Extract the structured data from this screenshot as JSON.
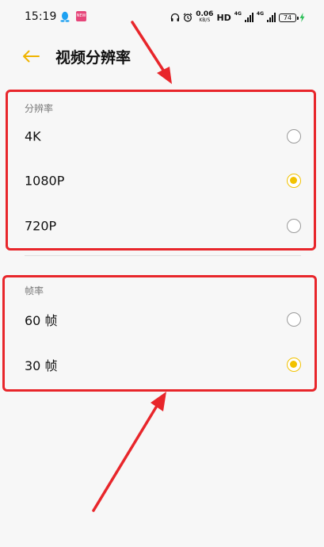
{
  "status_bar": {
    "time": "15:19",
    "app_icon_text": "NEW",
    "net_speed": "0.06",
    "net_speed_unit": "KB/S",
    "hd_label": "HD",
    "net_type_1": "4G",
    "net_type_2": "4G",
    "battery": "74"
  },
  "header": {
    "title": "视频分辨率"
  },
  "resolution_section": {
    "label": "分辨率",
    "options": [
      {
        "label": "4K",
        "selected": false
      },
      {
        "label": "1080P",
        "selected": true
      },
      {
        "label": "720P",
        "selected": false
      }
    ]
  },
  "frame_rate_section": {
    "label": "帧率",
    "options": [
      {
        "label": "60 帧",
        "selected": false
      },
      {
        "label": "30 帧",
        "selected": true
      }
    ]
  },
  "colors": {
    "accent": "#f2c200",
    "annotation": "#e8262b",
    "back_arrow": "#f0b400",
    "qq_icon": "#1da1f2",
    "app_icon": "#e6467a"
  },
  "icons": {
    "back": "arrow-left-icon",
    "qq": "qq-icon",
    "headphones": "headphones-icon",
    "alarm": "alarm-icon",
    "charging": "bolt-icon"
  }
}
